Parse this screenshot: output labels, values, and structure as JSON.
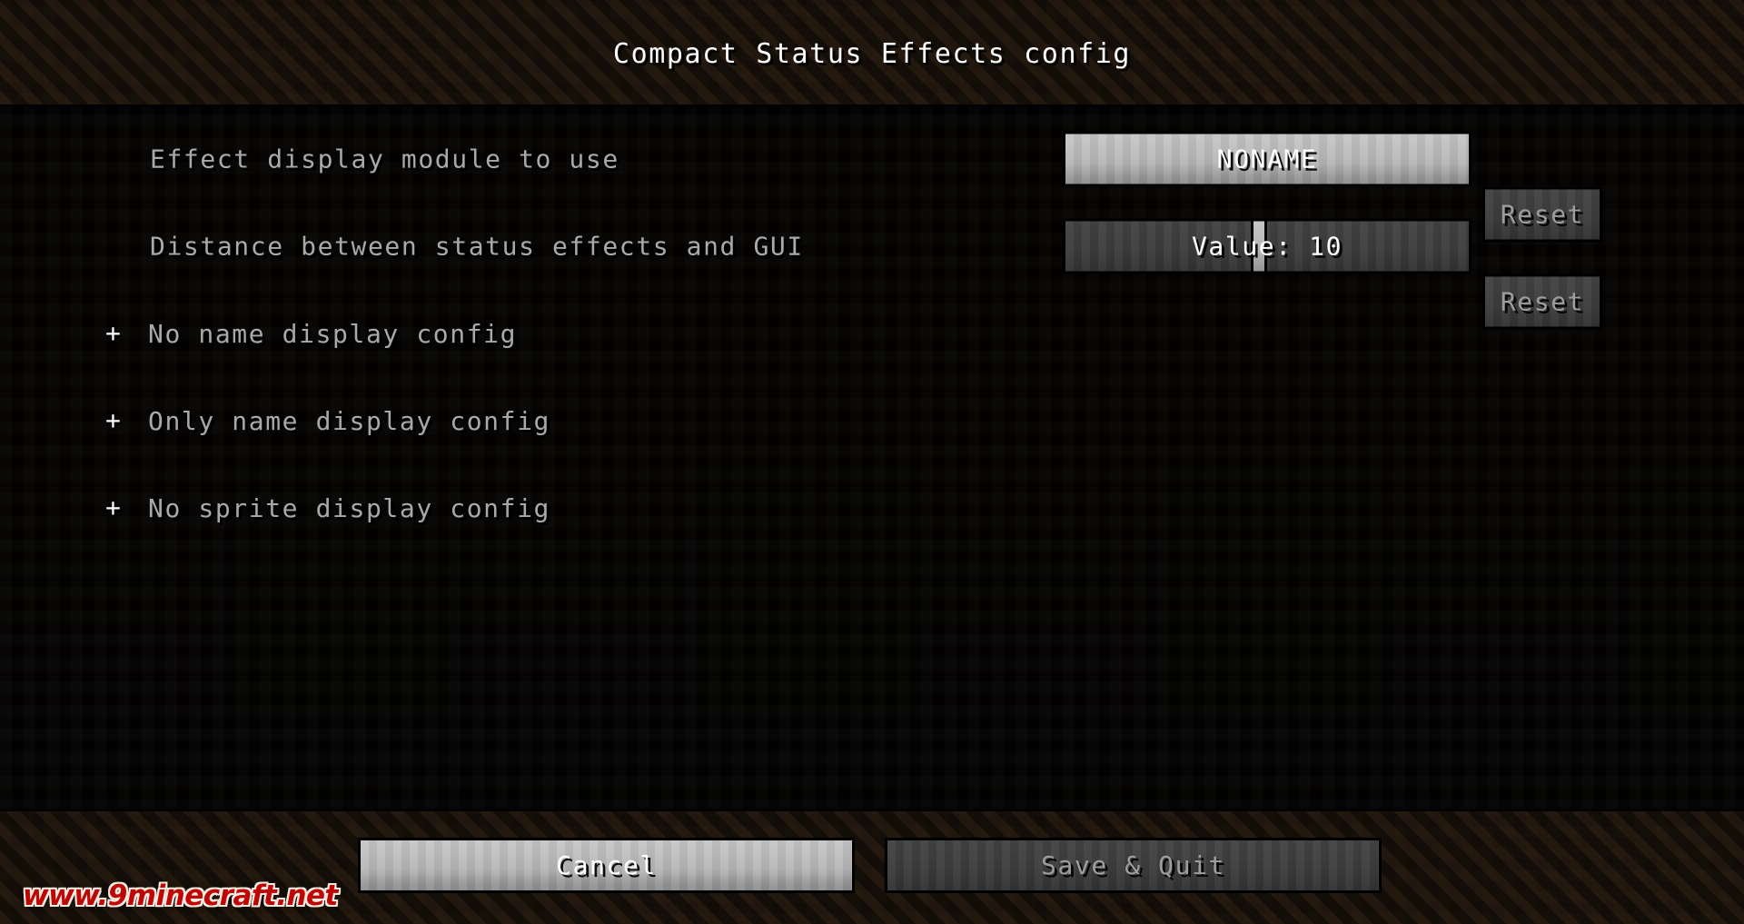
{
  "window": {
    "title": "Compact Status Effects config"
  },
  "options": [
    {
      "label": "Effect display module to use",
      "widget": "cycle-button",
      "value": "NONAME",
      "reset_label": "Reset",
      "reset_enabled": false
    },
    {
      "label": "Distance between status effects and GUI",
      "widget": "slider",
      "value_text": "Value: 10",
      "value": 10,
      "handle_percent": 48,
      "reset_label": "Reset",
      "reset_enabled": false
    }
  ],
  "categories": [
    {
      "expander": "+",
      "label": "No name display config",
      "expanded": false
    },
    {
      "expander": "+",
      "label": "Only name display config",
      "expanded": false
    },
    {
      "expander": "+",
      "label": "No sprite display config",
      "expanded": false
    }
  ],
  "footer": {
    "cancel_label": "Cancel",
    "save_label": "Save & Quit"
  },
  "watermark": {
    "text": "www.9minecraft.net"
  },
  "colors": {
    "dirt_background": "#271c12",
    "list_background": "#0d0906",
    "title_text": "#ffffff",
    "label_text": "#a9a9a9",
    "button_light": "#b6b6b6",
    "button_dark": "#3c3c3c",
    "button_light_text": "#ffffff",
    "button_dark_text": "#9d9d9d",
    "slider_handle": "#b4b4b4",
    "watermark_red": "#c00505"
  }
}
